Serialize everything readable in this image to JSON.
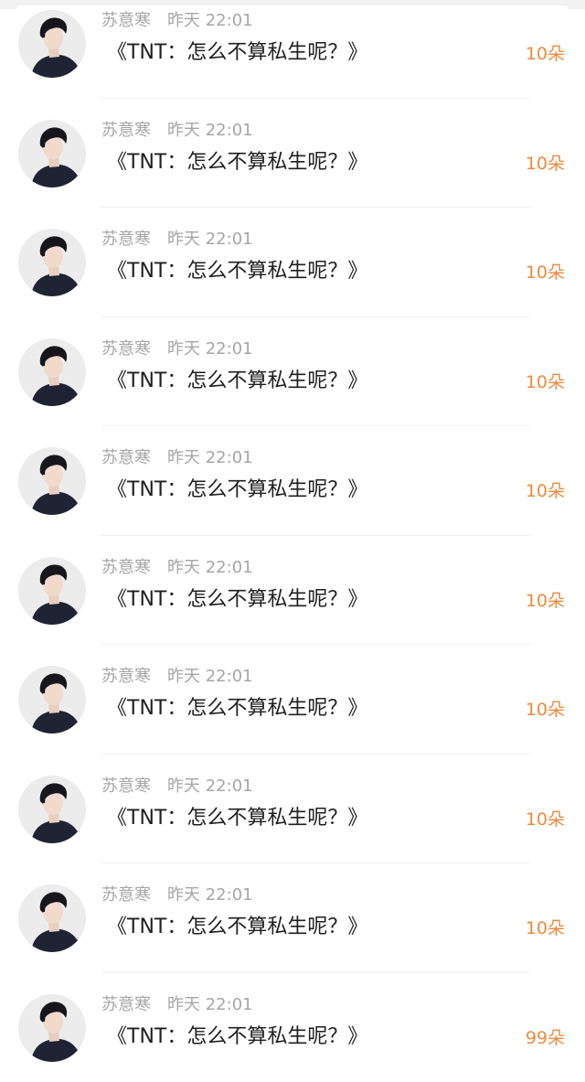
{
  "gift_list": {
    "items": [
      {
        "sender": "苏意寒",
        "time": "昨天 22:01",
        "work_title": "《TNT：怎么不算私生呢？》",
        "count": "10朵"
      },
      {
        "sender": "苏意寒",
        "time": "昨天 22:01",
        "work_title": "《TNT：怎么不算私生呢？》",
        "count": "10朵"
      },
      {
        "sender": "苏意寒",
        "time": "昨天 22:01",
        "work_title": "《TNT：怎么不算私生呢？》",
        "count": "10朵"
      },
      {
        "sender": "苏意寒",
        "time": "昨天 22:01",
        "work_title": "《TNT：怎么不算私生呢？》",
        "count": "10朵"
      },
      {
        "sender": "苏意寒",
        "time": "昨天 22:01",
        "work_title": "《TNT：怎么不算私生呢？》",
        "count": "10朵"
      },
      {
        "sender": "苏意寒",
        "time": "昨天 22:01",
        "work_title": "《TNT：怎么不算私生呢？》",
        "count": "10朵"
      },
      {
        "sender": "苏意寒",
        "time": "昨天 22:01",
        "work_title": "《TNT：怎么不算私生呢？》",
        "count": "10朵"
      },
      {
        "sender": "苏意寒",
        "time": "昨天 22:01",
        "work_title": "《TNT：怎么不算私生呢？》",
        "count": "10朵"
      },
      {
        "sender": "苏意寒",
        "time": "昨天 22:01",
        "work_title": "《TNT：怎么不算私生呢？》",
        "count": "10朵"
      },
      {
        "sender": "苏意寒",
        "time": "昨天 22:01",
        "work_title": "《TNT：怎么不算私生呢？》",
        "count": "99朵"
      }
    ]
  },
  "colors": {
    "count_accent": "#ee8a3e",
    "meta_text": "#a6a6a6",
    "title_text": "#1f1f1f"
  },
  "icons": {
    "avatar": "user-avatar-photo"
  }
}
